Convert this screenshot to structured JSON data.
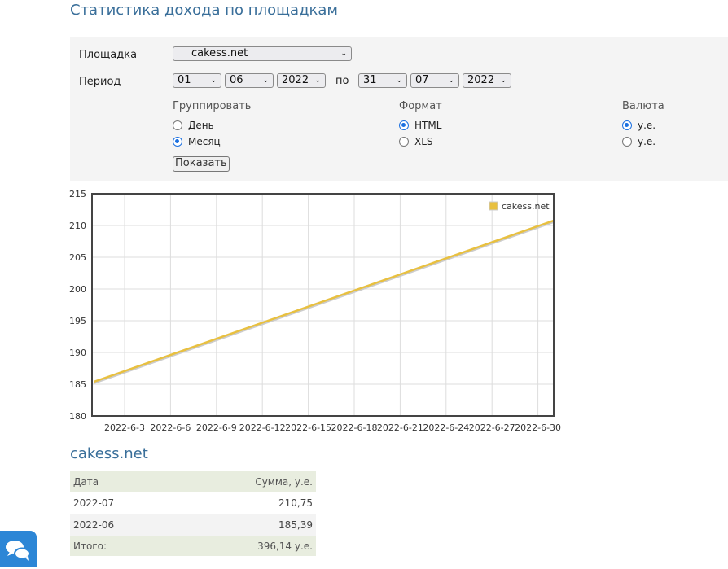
{
  "page_title": "Статистика дохода по площадкам",
  "form": {
    "site_label": "Площадка",
    "site_value": "cakess.net",
    "period_label": "Период",
    "from_day": "01",
    "from_month": "06",
    "from_year": "2022",
    "to_label": "по",
    "to_day": "31",
    "to_month": "07",
    "to_year": "2022",
    "group_label": "Группировать",
    "group_options": [
      "День",
      "Месяц"
    ],
    "group_selected": 1,
    "format_label": "Формат",
    "format_options": [
      "HTML",
      "XLS"
    ],
    "format_selected": 0,
    "currency_label": "Валюта",
    "currency_options": [
      "у.е.",
      "у.е."
    ],
    "currency_selected": 0,
    "submit_label": "Показать"
  },
  "chart_data": {
    "type": "line",
    "legend": [
      "cakess.net"
    ],
    "legend_position": "top-right",
    "series": [
      {
        "name": "cakess.net",
        "color": "#e8c040",
        "points": [
          {
            "x": "2022-6-1",
            "y": 185.39
          },
          {
            "x": "2022-7-1",
            "y": 210.75
          }
        ]
      }
    ],
    "xticks": [
      "2022-6-3",
      "2022-6-6",
      "2022-6-9",
      "2022-6-12",
      "2022-6-15",
      "2022-6-18",
      "2022-6-21",
      "2022-6-24",
      "2022-6-27",
      "2022-6-30"
    ],
    "yticks": [
      "180",
      "185",
      "190",
      "195",
      "200",
      "205",
      "210",
      "215"
    ],
    "ylim": [
      180,
      215
    ],
    "grid": true
  },
  "table": {
    "title": "cakess.net",
    "headers": [
      "Дата",
      "Сумма, у.е."
    ],
    "rows": [
      [
        "2022-07",
        "210,75"
      ],
      [
        "2022-06",
        "185,39"
      ]
    ],
    "total_label": "Итого:",
    "total_value": "396,14 у.е."
  }
}
